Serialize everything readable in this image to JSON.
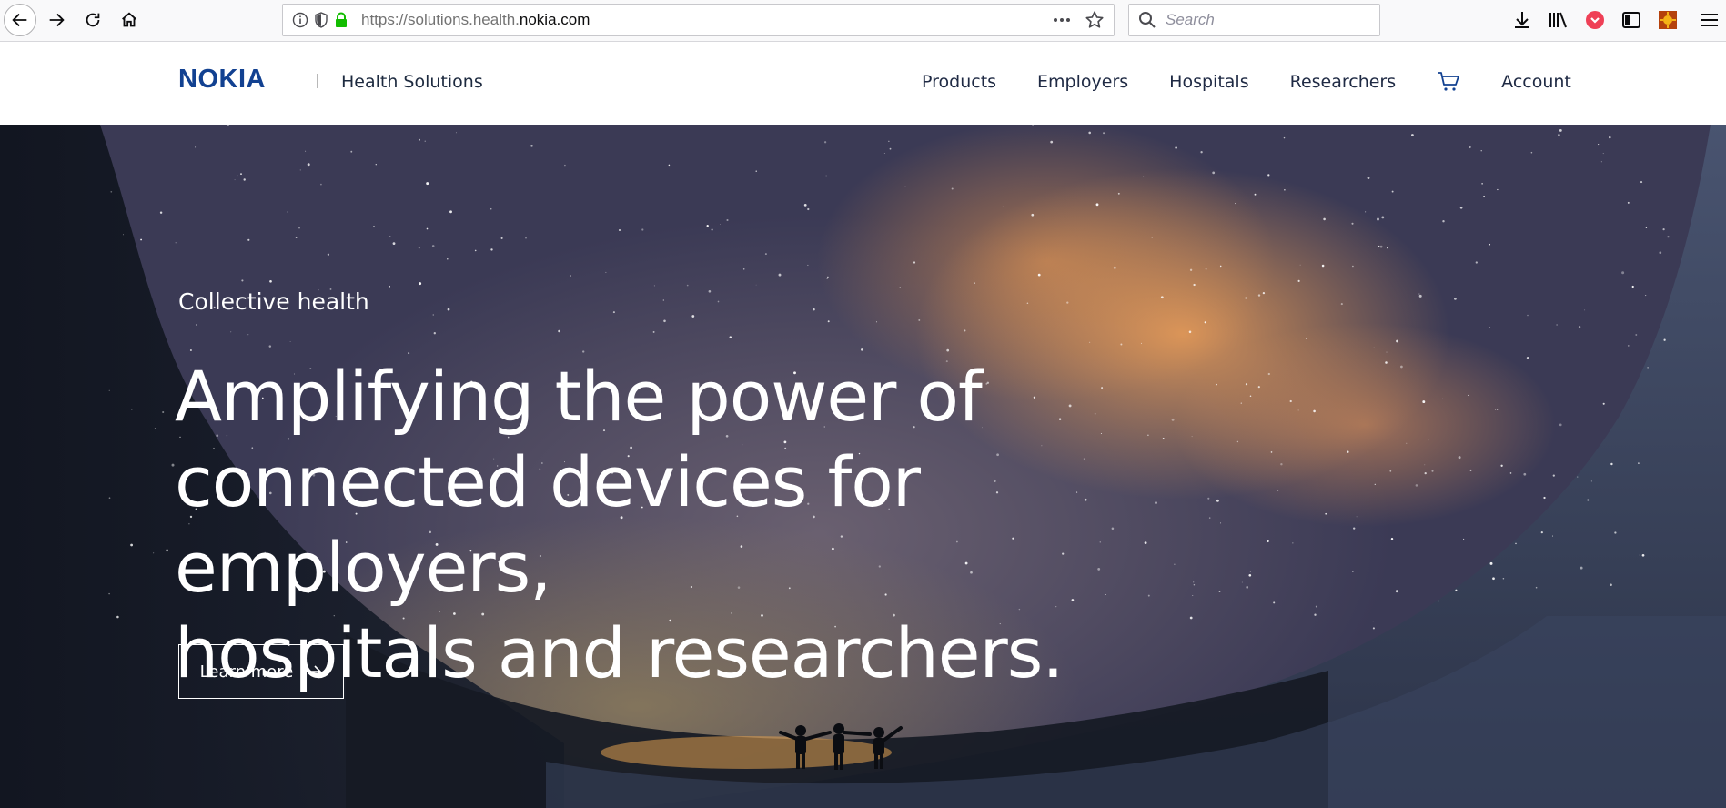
{
  "browser": {
    "url_prefix": "https://solutions.health.",
    "url_host": "nokia.com",
    "search_placeholder": "Search",
    "icons": [
      "back-icon",
      "forward-icon",
      "reload-icon",
      "home-icon",
      "info-icon",
      "tracking-shield-icon",
      "lock-icon",
      "more-icon",
      "bookmark-star-icon",
      "search-icon",
      "download-icon",
      "library-icon",
      "pocket-icon",
      "sidebar-icon",
      "extension-icon",
      "menu-icon"
    ]
  },
  "header": {
    "logo_text": "NOKIA",
    "subtitle": "Health Solutions",
    "nav": [
      "Products",
      "Employers",
      "Hospitals",
      "Researchers",
      "Account"
    ]
  },
  "hero": {
    "kicker": "Collective health",
    "title_lines": [
      "Amplifying the power of",
      "connected devices for employers,",
      "hospitals and researchers."
    ],
    "cta_label": "Learn more"
  },
  "colors": {
    "brand_blue": "#124191",
    "lock_green": "#12bc00",
    "pocket_red": "#ef4056",
    "hero_text": "#ffffff"
  }
}
